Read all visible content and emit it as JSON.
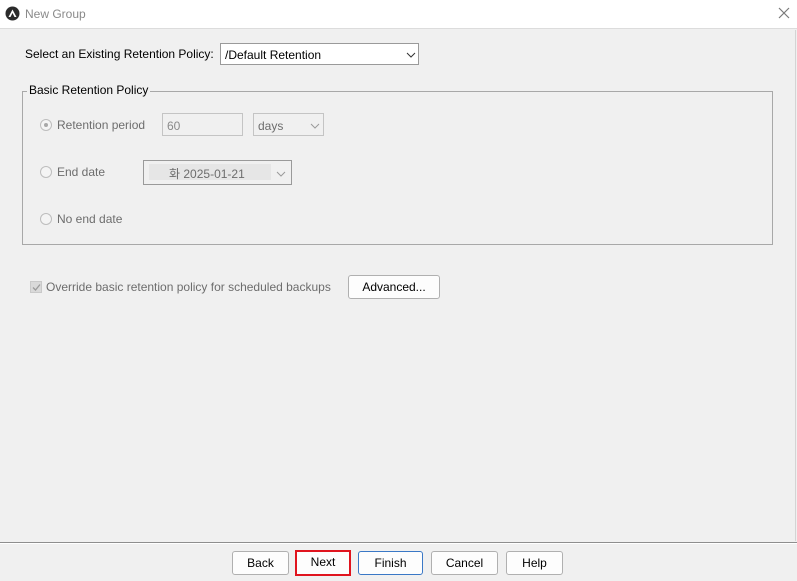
{
  "window": {
    "title": "New Group"
  },
  "policy": {
    "label": "Select an Existing Retention Policy:",
    "selected": "/Default Retention"
  },
  "basic_policy": {
    "legend": "Basic Retention Policy",
    "retention_period": {
      "label": "Retention period",
      "value": "60",
      "unit": "days",
      "selected": true
    },
    "end_date": {
      "label": "End date",
      "value": "화 2025-01-21"
    },
    "no_end_date": {
      "label": "No end date"
    }
  },
  "override": {
    "label": "Override basic retention policy for scheduled backups",
    "checked": true,
    "advanced_label": "Advanced..."
  },
  "footer": {
    "back": "Back",
    "next": "Next",
    "finish": "Finish",
    "cancel": "Cancel",
    "help": "Help"
  },
  "colors": {
    "highlight": "#e0141e",
    "default_button_border": "#3a78c6"
  }
}
